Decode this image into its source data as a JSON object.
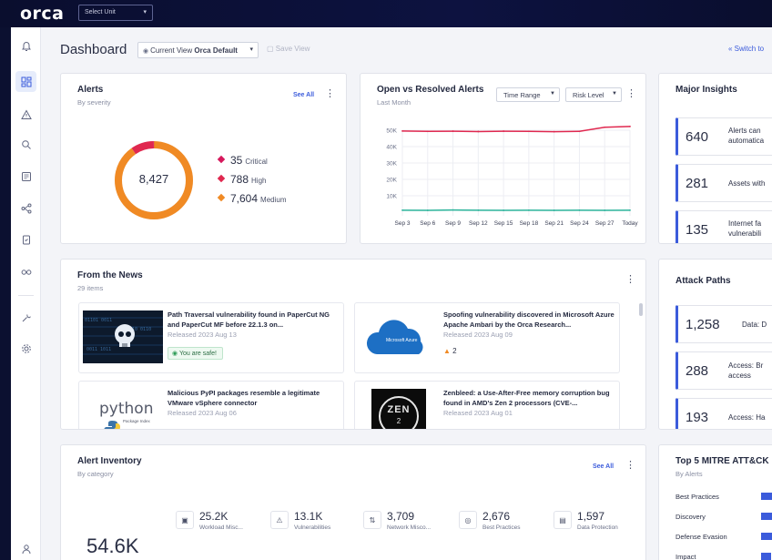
{
  "topbar": {
    "logo": "orca",
    "unit_select": "Select Unit"
  },
  "sidebar": {
    "items": [
      {
        "icon": "bell-icon"
      },
      {
        "icon": "dashboard-icon",
        "active": true
      },
      {
        "icon": "alert-triangle-icon"
      },
      {
        "icon": "search-icon"
      },
      {
        "icon": "inventory-icon"
      },
      {
        "icon": "graph-icon"
      },
      {
        "icon": "clipboard-icon"
      },
      {
        "icon": "glasses-icon"
      },
      {
        "icon": "wrench-icon"
      },
      {
        "icon": "gear-icon"
      },
      {
        "icon": "user-icon"
      }
    ]
  },
  "header": {
    "title": "Dashboard",
    "view_prefix": "Current View",
    "view_name": "Orca Default",
    "save_view": "Save View",
    "switch_to": "Switch to"
  },
  "alerts_card": {
    "title": "Alerts",
    "subtitle": "By severity",
    "see_all": "See All",
    "total": "8,427",
    "rows": [
      {
        "value": "35",
        "label": "Critical",
        "color": "#d6185c",
        "fraction": 0.0042
      },
      {
        "value": "788",
        "label": "High",
        "color": "#e0284f",
        "fraction": 0.0935
      },
      {
        "value": "7,604",
        "label": "Medium",
        "color": "#f08a24",
        "fraction": 0.9023
      }
    ]
  },
  "chart_data": {
    "type": "line",
    "title": "Open vs Resolved Alerts",
    "subtitle": "Last Month",
    "x": [
      "Sep 3",
      "Sep 6",
      "Sep 9",
      "Sep 12",
      "Sep 15",
      "Sep 18",
      "Sep 21",
      "Sep 24",
      "Sep 27",
      "Today"
    ],
    "yticks": [
      "50K",
      "40K",
      "30K",
      "20K",
      "10K"
    ],
    "ylim": [
      0,
      50000
    ],
    "series": [
      {
        "color": "#e0284f",
        "values": [
          49500,
          49300,
          49400,
          49200,
          49400,
          49300,
          49100,
          49300,
          51800,
          52300
        ]
      },
      {
        "color": "#2bb39a",
        "values": [
          1200,
          1100,
          1300,
          1200,
          1100,
          1200,
          1100,
          1200,
          1100,
          1200
        ]
      }
    ],
    "grid": true,
    "controls": {
      "time_range": "Time Range",
      "risk_level": "Risk Level"
    }
  },
  "insights": {
    "title": "Major Insights",
    "items": [
      {
        "value": "640",
        "text": "Alerts can automatica"
      },
      {
        "value": "281",
        "text": "Assets with"
      },
      {
        "value": "135",
        "text": "Internet fa vulnerabili"
      }
    ]
  },
  "news": {
    "title": "From the News",
    "subtitle": "29 items",
    "items": [
      {
        "title": "Path Traversal vulnerability found in PaperCut NG and PaperCut MF before 22.1.3 on...",
        "date": "Released 2023 Aug 13",
        "badge": "You are safe!",
        "thumb": "skull"
      },
      {
        "title": "Spoofing vulnerability discovered in Microsoft Azure Apache Ambari by the Orca Research...",
        "date": "Released 2023 Aug 09",
        "badge": "2",
        "thumb": "azure",
        "thumb_caption": "Microsoft Azure"
      },
      {
        "title": "Malicious PyPI packages resemble a legitimate VMware vSphere connector",
        "date": "Released 2023 Aug 06",
        "badge": "",
        "thumb": "python",
        "thumb_caption": "python",
        "thumb_caption2": "Package Index"
      },
      {
        "title": "Zenbleed: a Use-After-Free memory corruption bug found in AMD's Zen 2 processors (CVE-...",
        "date": "Released 2023 Aug 01",
        "badge": "",
        "thumb": "zen",
        "thumb_caption": "ZEN",
        "thumb_caption2": "2"
      }
    ]
  },
  "attack_paths": {
    "title": "Attack Paths",
    "items": [
      {
        "value": "1,258",
        "text": "Data: D"
      },
      {
        "value": "288",
        "text": "Access: Br access"
      },
      {
        "value": "193",
        "text": "Access: Ha"
      }
    ]
  },
  "inventory": {
    "title": "Alert Inventory",
    "subtitle": "By category",
    "see_all": "See All",
    "total": "54.6K",
    "stats": [
      {
        "value": "25.2K",
        "label": "Workload Misc...",
        "icon": "workload-icon"
      },
      {
        "value": "13.1K",
        "label": "Vulnerabilities",
        "icon": "vulnerability-icon"
      },
      {
        "value": "3,709",
        "label": "Network Misco...",
        "icon": "network-icon"
      },
      {
        "value": "2,676",
        "label": "Best Practices",
        "icon": "best-practice-icon"
      },
      {
        "value": "1,597",
        "label": "Data Protection",
        "icon": "data-protection-icon"
      }
    ]
  },
  "mitre": {
    "title": "Top 5 MITRE ATT&CK",
    "subtitle": "By Alerts",
    "rows": [
      {
        "label": "Best Practices",
        "fraction": 0.9
      },
      {
        "label": "Discovery",
        "fraction": 0.6
      },
      {
        "label": "Defense Evasion",
        "fraction": 0.5
      },
      {
        "label": "Impact",
        "fraction": 0.4
      }
    ]
  }
}
